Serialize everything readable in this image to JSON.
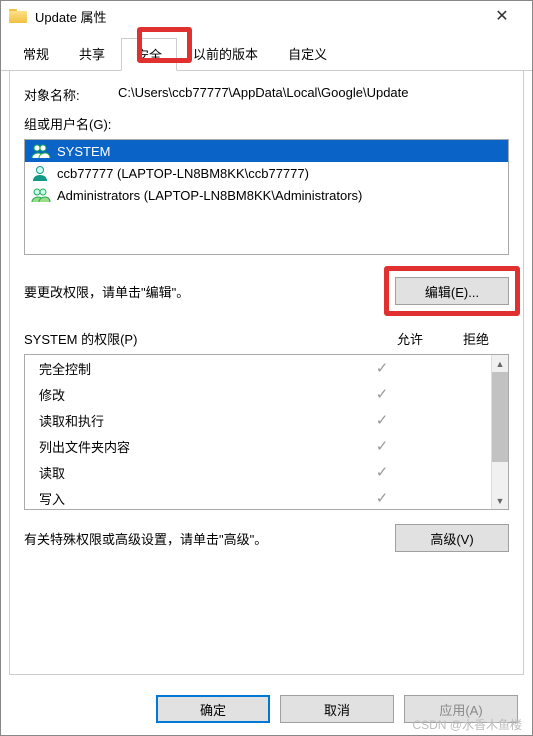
{
  "titlebar": {
    "title": "Update 属性"
  },
  "tabs": {
    "items": [
      {
        "label": "常规"
      },
      {
        "label": "共享"
      },
      {
        "label": "安全"
      },
      {
        "label": "以前的版本"
      },
      {
        "label": "自定义"
      }
    ],
    "active_index": 2
  },
  "object": {
    "label": "对象名称:",
    "value": "C:\\Users\\ccb77777\\AppData\\Local\\Google\\Update"
  },
  "group_label": "组或用户名(G):",
  "principals": [
    {
      "name": "SYSTEM",
      "icon": "group",
      "selected": true
    },
    {
      "name": "ccb77777 (LAPTOP-LN8BM8KK\\ccb77777)",
      "icon": "user",
      "selected": false
    },
    {
      "name": "Administrators (LAPTOP-LN8BM8KK\\Administrators)",
      "icon": "group",
      "selected": false
    }
  ],
  "edit": {
    "hint": "要更改权限，请单击\"编辑\"。",
    "button": "编辑(E)..."
  },
  "permissions": {
    "header_name": "SYSTEM 的权限(P)",
    "header_allow": "允许",
    "header_deny": "拒绝",
    "rows": [
      {
        "name": "完全控制",
        "allow": true,
        "deny": false
      },
      {
        "name": "修改",
        "allow": true,
        "deny": false
      },
      {
        "name": "读取和执行",
        "allow": true,
        "deny": false
      },
      {
        "name": "列出文件夹内容",
        "allow": true,
        "deny": false
      },
      {
        "name": "读取",
        "allow": true,
        "deny": false
      },
      {
        "name": "写入",
        "allow": true,
        "deny": false
      }
    ]
  },
  "advanced": {
    "hint": "有关特殊权限或高级设置，请单击\"高级\"。",
    "button": "高级(V)"
  },
  "footer": {
    "ok": "确定",
    "cancel": "取消",
    "apply": "应用(A)"
  },
  "watermark": "CSDN @水香木鱼楼"
}
